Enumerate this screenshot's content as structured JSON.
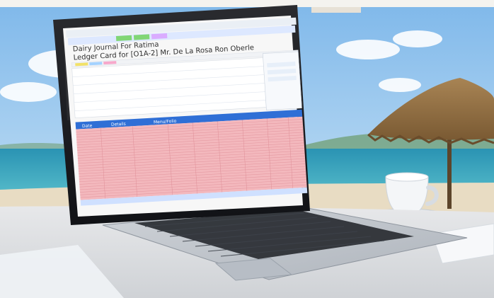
{
  "screen": {
    "app_title": "Dairy Journal For Ratima",
    "ledger_title": "Ledger Card for [O1A-2] Mr. De La Rosa Ron Oberle",
    "table": {
      "columns": [
        "Date",
        "Details",
        "Menu/Folio"
      ],
      "row_count": 27
    }
  },
  "colors": {
    "table_rows": "#f3b8bd",
    "table_header": "#2f6fd6",
    "laptop_body": "#c8ccd2",
    "sea": "#2f9ab6"
  }
}
